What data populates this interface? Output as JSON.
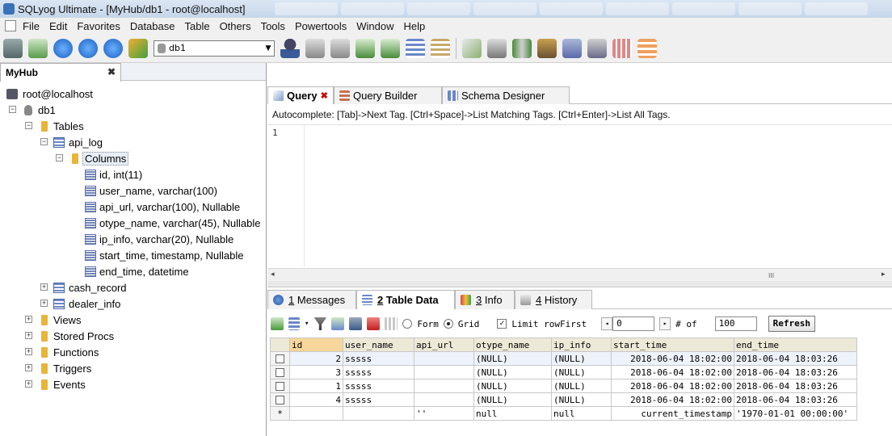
{
  "window": {
    "title": "SQLyog Ultimate - [MyHub/db1 - root@localhost]"
  },
  "menu": [
    "File",
    "Edit",
    "Favorites",
    "Database",
    "Table",
    "Others",
    "Tools",
    "Powertools",
    "Window",
    "Help"
  ],
  "toolbar": {
    "db_select": "db1"
  },
  "left_tab": {
    "label": "MyHub",
    "close": "✖"
  },
  "tree": {
    "server": "root@localhost",
    "db": "db1",
    "tables_folder": "Tables",
    "table_api_log": "api_log",
    "columns_folder": "Columns",
    "columns": [
      "id, int(11)",
      "user_name, varchar(100)",
      "api_url, varchar(100), Nullable",
      "otype_name, varchar(45), Nullable",
      "ip_info, varchar(20), Nullable",
      "start_time, timestamp, Nullable",
      "end_time, datetime"
    ],
    "table_cash": "cash_record",
    "table_dealer": "dealer_info",
    "views": "Views",
    "procs": "Stored Procs",
    "functions": "Functions",
    "triggers": "Triggers",
    "events": "Events",
    "toggle_minus": "−",
    "toggle_plus": "+"
  },
  "query_tabs": [
    {
      "label": "Query",
      "close": "✖"
    },
    {
      "label": "Query Builder"
    },
    {
      "label": "Schema Designer"
    }
  ],
  "autocomplete": "Autocomplete: [Tab]->Next Tag. [Ctrl+Space]->List Matching Tags. [Ctrl+Enter]->List All Tags.",
  "editor": {
    "line_number": "1"
  },
  "scroll": {
    "left": "◂",
    "right": "▸",
    "thumb": "III"
  },
  "result_tabs": [
    {
      "num": "1",
      "label": "Messages"
    },
    {
      "num": "2",
      "label": "Table Data"
    },
    {
      "num": "3",
      "label": "Info"
    },
    {
      "num": "4",
      "label": "History"
    }
  ],
  "gridbar": {
    "form": "Form",
    "grid": "Grid",
    "limit": "Limit rowFirst",
    "first": "0",
    "of": "# of",
    "count": "100",
    "refresh": "Refresh",
    "dropdown": "▾",
    "prev": "◂",
    "next": "▸",
    "checked": "✓"
  },
  "table": {
    "columns": [
      "id",
      "user_name",
      "api_url",
      "otype_name",
      "ip_info",
      "start_time",
      "end_time"
    ],
    "rows": [
      {
        "id": "2",
        "user_name": "sssss",
        "api_url": "",
        "otype_name": "(NULL)",
        "ip_info": "(NULL)",
        "start_time": "2018-06-04 18:02:00",
        "end_time": "2018-06-04 18:03:26"
      },
      {
        "id": "3",
        "user_name": "sssss",
        "api_url": "",
        "otype_name": "(NULL)",
        "ip_info": "(NULL)",
        "start_time": "2018-06-04 18:02:00",
        "end_time": "2018-06-04 18:03:26"
      },
      {
        "id": "1",
        "user_name": "sssss",
        "api_url": "",
        "otype_name": "(NULL)",
        "ip_info": "(NULL)",
        "start_time": "2018-06-04 18:02:00",
        "end_time": "2018-06-04 18:03:26"
      },
      {
        "id": "4",
        "user_name": "sssss",
        "api_url": "",
        "otype_name": "(NULL)",
        "ip_info": "(NULL)",
        "start_time": "2018-06-04 18:02:00",
        "end_time": "2018-06-04 18:03:26"
      }
    ],
    "new_row": {
      "marker": "*",
      "id": "",
      "user_name": "",
      "api_url": "''",
      "otype_name": "null",
      "ip_info": "null",
      "start_time": "current_timestamp",
      "end_time": "'1970-01-01 00:00:00'"
    }
  },
  "colors": {
    "accent": "#f6d69a",
    "folder": "#e8b53a",
    "row_selected": "#eef2fb"
  }
}
